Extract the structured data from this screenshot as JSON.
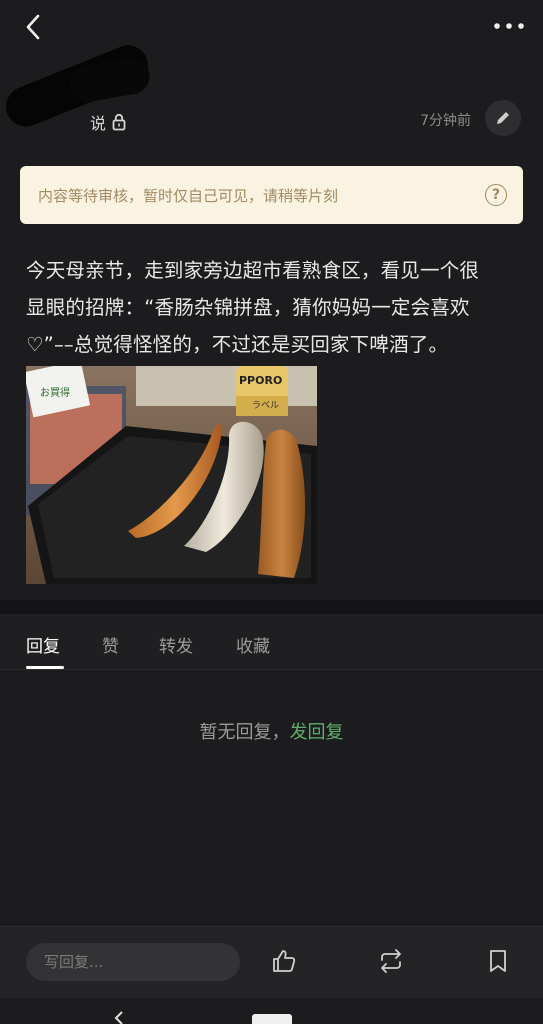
{
  "header": {
    "back_icon": "chevron-left-icon",
    "more_icon": "more-dots-icon"
  },
  "author": {
    "visibility_label": "说",
    "visibility_icon": "lock-icon",
    "time": "7分钟前",
    "edit_icon": "pencil-icon"
  },
  "notice": {
    "text": "内容等待审核，暂时仅自己可见，请稍等片刻",
    "help_icon": "question-circle-icon",
    "help_glyph": "?"
  },
  "post": {
    "line1": "今天母亲节，走到家旁边超市看熟食区，看见一个很",
    "line2": "显眼的招牌：“香肠杂锦拼盘，猜你妈妈一定会喜欢",
    "line3": "♡”––总觉得怪怪的，不过还是买回家下啤酒了。",
    "photo_label_can": "PPORO",
    "photo_label_can2": "ラベル",
    "photo_label_pack": "お買得"
  },
  "tabs": [
    {
      "label": "回复",
      "active": true
    },
    {
      "label": "赞",
      "active": false
    },
    {
      "label": "转发",
      "active": false
    },
    {
      "label": "收藏",
      "active": false
    }
  ],
  "empty_state": {
    "text": "暂无回复，",
    "link": "发回复"
  },
  "bottom_bar": {
    "reply_placeholder": "写回复...",
    "like_icon": "thumbs-up-icon",
    "repost_icon": "repost-icon",
    "bookmark_icon": "bookmark-icon"
  },
  "colors": {
    "background": "#1c1c1e",
    "notice_bg": "#fbf3e1",
    "notice_text": "#a08a62",
    "link_green": "#5fae6a"
  }
}
